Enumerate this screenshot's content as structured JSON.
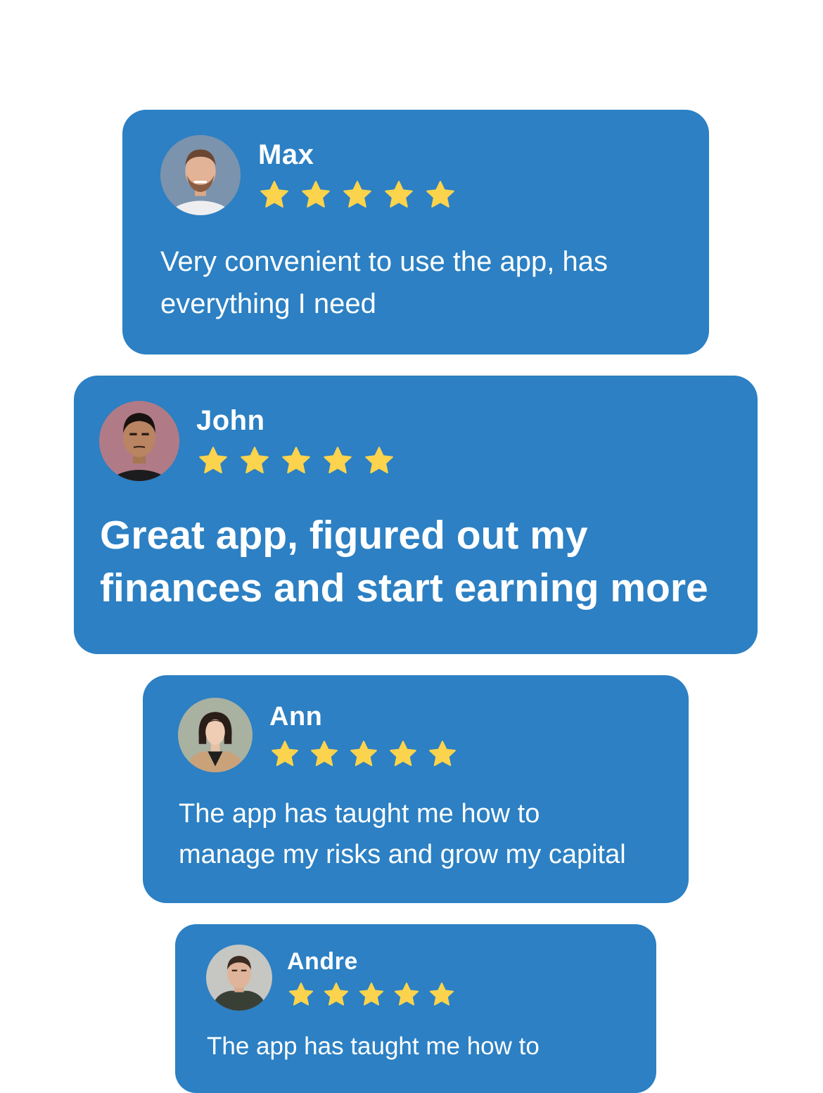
{
  "reviews": [
    {
      "name": "Max",
      "rating": 5,
      "text_lines": [
        "Very convenient to use the app, has",
        "everything I need"
      ]
    },
    {
      "name": "John",
      "rating": 5,
      "text_lines": [
        "Great app, figured out my",
        "finances and start earning more"
      ]
    },
    {
      "name": "Ann",
      "rating": 5,
      "text_lines": [
        "The app has taught me how to",
        "manage  my risks and grow my capital"
      ]
    },
    {
      "name": "Andre",
      "rating": 5,
      "text_lines": [
        "The app has taught me how to"
      ]
    }
  ],
  "colors": {
    "card_background": "#2c80c3",
    "star": "#fcd34d",
    "text": "#ffffff",
    "page_background": "#ffffff"
  },
  "icons": {
    "star": "star-icon",
    "avatar": "avatar-photo"
  }
}
